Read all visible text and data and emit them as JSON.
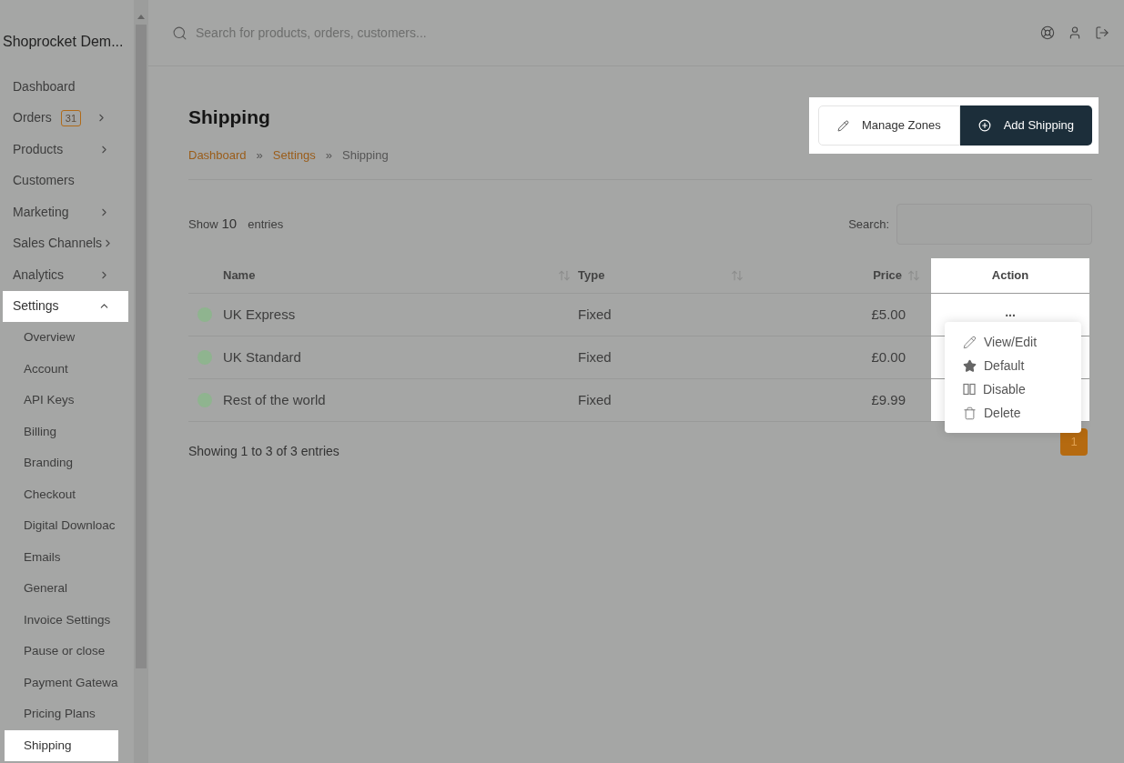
{
  "sidebar": {
    "title": "Shoprocket Dem...",
    "items": [
      {
        "label": "Dashboard",
        "kind": "link",
        "selected": false
      },
      {
        "label": "Orders",
        "badge": "31",
        "kind": "group",
        "expanded": false,
        "selected": false
      },
      {
        "label": "Products",
        "kind": "group",
        "expanded": false,
        "selected": false
      },
      {
        "label": "Customers",
        "kind": "link",
        "selected": false
      },
      {
        "label": "Marketing",
        "kind": "group",
        "expanded": false,
        "selected": false
      },
      {
        "label": "Sales Channels",
        "kind": "group",
        "expanded": false,
        "selected": false
      },
      {
        "label": "Analytics",
        "kind": "group",
        "expanded": false,
        "selected": false
      },
      {
        "label": "Settings",
        "kind": "group",
        "expanded": true,
        "selected": true,
        "children": [
          {
            "label": "Overview",
            "selected": false
          },
          {
            "label": "Account",
            "selected": false
          },
          {
            "label": "API Keys",
            "selected": false
          },
          {
            "label": "Billing",
            "selected": false
          },
          {
            "label": "Branding",
            "selected": false
          },
          {
            "label": "Checkout",
            "selected": false
          },
          {
            "label": "Digital Downloac",
            "selected": false
          },
          {
            "label": "Emails",
            "selected": false
          },
          {
            "label": "General",
            "selected": false
          },
          {
            "label": "Invoice Settings",
            "selected": false
          },
          {
            "label": "Pause or close",
            "selected": false
          },
          {
            "label": "Payment Gatewa",
            "selected": false
          },
          {
            "label": "Pricing Plans",
            "selected": false
          },
          {
            "label": "Shipping",
            "selected": true
          }
        ]
      }
    ]
  },
  "topbar": {
    "search": {
      "placeholder": "Search for products, orders, customers..."
    }
  },
  "page": {
    "title": "Shipping",
    "breadcrumb": [
      {
        "label": "Dashboard",
        "link": true
      },
      {
        "label": "»",
        "link": false
      },
      {
        "label": "Settings",
        "link": true
      },
      {
        "label": "»",
        "link": false
      },
      {
        "label": "Shipping",
        "link": false
      }
    ],
    "buttons": [
      {
        "label": "Manage Zones",
        "kind": "outline"
      },
      {
        "label": "Add Shipping",
        "kind": "primary"
      }
    ]
  },
  "table": {
    "length": {
      "before": "Show",
      "value": "10",
      "after": "entries"
    },
    "search": {
      "label": "Search:"
    },
    "columns": [
      {
        "label": "Name",
        "sortable": true,
        "kind": "text"
      },
      {
        "label": "Type",
        "sortable": true,
        "kind": "text"
      },
      {
        "label": "Price",
        "sortable": true,
        "kind": "money"
      },
      {
        "label": "Action",
        "sortable": false,
        "kind": "action"
      }
    ],
    "rows": [
      {
        "color": "#8fb48f",
        "name": "UK Express",
        "type": "Fixed",
        "price": "£5.00",
        "action": "..."
      },
      {
        "color": "#8fb48f",
        "name": "UK Standard",
        "type": "Fixed",
        "price": "£0.00"
      },
      {
        "color": "#8fb48f",
        "name": "Rest of the world",
        "type": "Fixed",
        "price": "£9.99"
      }
    ],
    "menu": [
      {
        "label": "View/Edit"
      },
      {
        "label": "Default"
      },
      {
        "label": "Disable"
      },
      {
        "label": "Delete"
      }
    ],
    "info": "Showing 1 to 3 of 3 entries",
    "pages": [
      {
        "label": "1",
        "selected": true
      }
    ]
  }
}
